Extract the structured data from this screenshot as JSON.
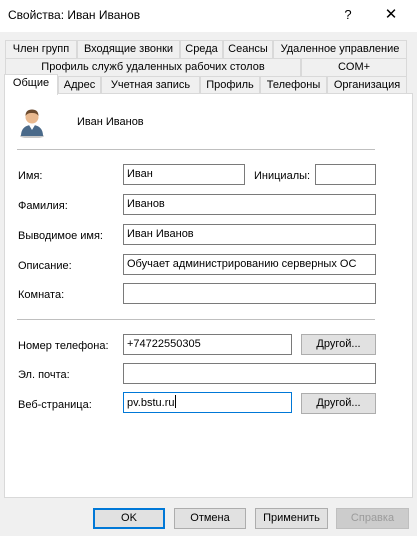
{
  "window": {
    "title": "Свойства: Иван Иванов",
    "help_glyph": "?",
    "close_glyph": "✕"
  },
  "tabs": {
    "row1": [
      "Член групп",
      "Входящие звонки",
      "Среда",
      "Сеансы",
      "Удаленное управление"
    ],
    "row2": [
      "Профиль служб удаленных рабочих столов",
      "COM+"
    ],
    "row3": [
      "Общие",
      "Адрес",
      "Учетная запись",
      "Профиль",
      "Телефоны",
      "Организация"
    ],
    "active": "Общие"
  },
  "user": {
    "display": "Иван Иванов",
    "avatar_icon": "user-avatar-icon"
  },
  "form": {
    "first_name_label": "Имя:",
    "first_name_value": "Иван",
    "initials_label": "Инициалы:",
    "initials_value": "",
    "last_name_label": "Фамилия:",
    "last_name_value": "Иванов",
    "display_name_label": "Выводимое имя:",
    "display_name_value": "Иван Иванов",
    "description_label": "Описание:",
    "description_value": "Обучает администрированию серверных ОС",
    "office_label": "Комната:",
    "office_value": "",
    "phone_label": "Номер телефона:",
    "phone_value": "+74722550305",
    "phone_other_button": "Другой...",
    "email_label": "Эл. почта:",
    "email_value": "",
    "web_label": "Веб-страница:",
    "web_value": "pv.bstu.ru",
    "web_other_button": "Другой..."
  },
  "buttons": {
    "ok": "OK",
    "cancel": "Отмена",
    "apply": "Применить",
    "help": "Справка"
  },
  "colors": {
    "focus_border": "#0078d7",
    "window_bg": "#f0f0f0",
    "panel_bg": "#ffffff"
  }
}
